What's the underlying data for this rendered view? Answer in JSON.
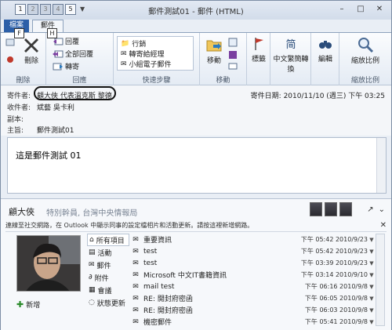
{
  "window": {
    "title": "郵件測試01 - 郵件 (HTML)"
  },
  "qat": {
    "keys": [
      "1",
      "2",
      "3",
      "4",
      "5"
    ]
  },
  "tabs": {
    "file": "檔案",
    "message": "郵件",
    "keytip_file": "F",
    "keytip_message": "H"
  },
  "ribbon": {
    "delete": {
      "label": "刪除",
      "group": "刪除"
    },
    "respond": {
      "reply": "回覆",
      "reply_all": "全部回覆",
      "forward": "轉寄",
      "group": "回應"
    },
    "quick_steps": {
      "items": [
        "行銷",
        "轉寄給經理",
        "小組電子郵件"
      ],
      "group": "快速步驟"
    },
    "move": {
      "label": "移動",
      "group": "移動"
    },
    "tags": {
      "label": "標籤"
    },
    "chinese": {
      "label": "中文繁簡轉換"
    },
    "edit": {
      "label": "編輯"
    },
    "zoom": {
      "label": "縮放比例",
      "group": "縮放比例"
    }
  },
  "header": {
    "from_label": "寄件者:",
    "from_value": "顧大俠 代表溫克斯 黎德",
    "to_label": "收件者:",
    "to_value": "斌藝 吳卡利",
    "cc_label": "副本:",
    "subject_label": "主旨:",
    "subject_value": "郵件測試01",
    "sent_label": "寄件日期:",
    "sent_value": "2010/11/10 (週三) 下午 03:25"
  },
  "body": {
    "text": "這是郵件測試 01"
  },
  "social": {
    "name": "顧大俠",
    "title": "特別幹員, 台灣中央情報局",
    "infobar": "連線至社交網路，在 Outlook 中顯示同事的設定檔相片和活動更新。請按這裡新增網路。",
    "add_label": "新增",
    "nav": [
      "所有項目",
      "活動",
      "郵件",
      "附件",
      "會議",
      "狀態更新"
    ],
    "rows": [
      {
        "subject": "重要資訊",
        "date": "下午 05:42 2010/9/23"
      },
      {
        "subject": "test",
        "date": "下午 05:42 2010/9/23"
      },
      {
        "subject": "test",
        "date": "下午 03:39 2010/9/23"
      },
      {
        "subject": "Microsoft 中文IT書籍資訊",
        "date": "下午 03:14 2010/9/10"
      },
      {
        "subject": "mail test",
        "date": "下午 06:16 2010/9/8"
      },
      {
        "subject": "RE: 開封府密函",
        "date": "下午 06:05 2010/9/8"
      },
      {
        "subject": "RE: 開封府密函",
        "date": "下午 06:03 2010/9/8"
      },
      {
        "subject": "機密郵件",
        "date": "下午 05:41 2010/9/8"
      }
    ]
  }
}
